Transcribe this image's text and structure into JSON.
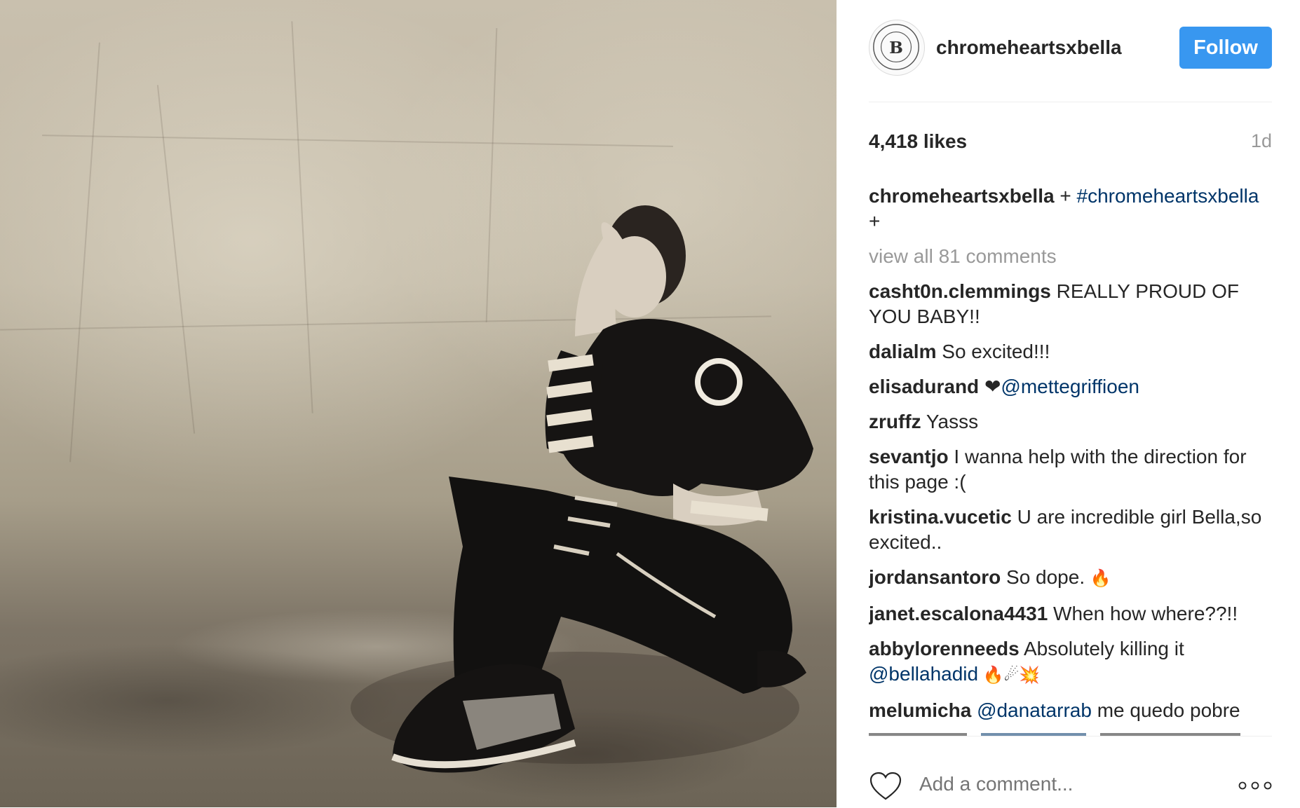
{
  "post": {
    "image_alt": "black and white photo of model seated wearing striped-sleeve jacket and high-top sneakers"
  },
  "header": {
    "username": "chromeheartsxbella",
    "avatar_letter": "B",
    "follow_label": "Follow"
  },
  "stats": {
    "likes": "4,418 likes",
    "age": "1d"
  },
  "caption": {
    "username": "chromeheartsxbella",
    "text_before": " + ",
    "hashtag": "#chromeheartsxbella",
    "text_after": " +"
  },
  "view_all": "view all 81 comments",
  "comments": [
    {
      "user": "casht0n.clemmings",
      "text": " REALLY PROUD OF YOU BABY!!"
    },
    {
      "user": "dalialm",
      "text": " So excited!!!"
    },
    {
      "user": "elisadurand",
      "text": " ❤",
      "mention": "@mettegriffioen"
    },
    {
      "user": "zruffz",
      "text": " Yasss"
    },
    {
      "user": "sevantjo",
      "text": " I wanna help with the direction for this page :("
    },
    {
      "user": "kristina.vucetic",
      "text": " U are incredible girl Bella,so excited.."
    },
    {
      "user": "jordansantoro",
      "text": " So dope. ",
      "emoji": "🔥"
    },
    {
      "user": "janet.escalona4431",
      "text": " When how where??!!"
    },
    {
      "user": "abbylorenneeds",
      "text": " Absolutely killing it ",
      "mention": "@bellahadid",
      "emoji": " 🔥☄💥"
    },
    {
      "user": "melumicha",
      "mention": "@danatarrab",
      "text": " me quedo pobre"
    }
  ],
  "footer": {
    "add_comment_placeholder": "Add a comment...",
    "heart_icon": "heart-outline-icon",
    "more_icon": "more-options-icon"
  },
  "colors": {
    "follow_bg": "#3897f0",
    "link": "#003569",
    "muted": "#999999"
  }
}
